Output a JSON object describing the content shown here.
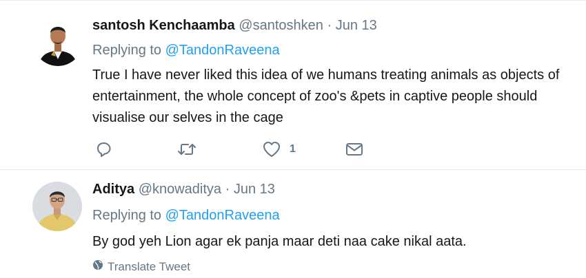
{
  "tweets": [
    {
      "fullname": "santosh Kenchaamba",
      "handle": "@santoshken",
      "separator": "·",
      "time": "Jun 13",
      "replying_prefix": "Replying to",
      "replying_to": "@TandonRaveena",
      "text": "True I have never liked this idea of we humans treating animals as objects of entertainment, the whole concept of zoo's  &pets in captive people should visualise our selves in the cage",
      "actions": {
        "reply_icon": "reply-icon",
        "retweet_icon": "retweet-icon",
        "like_icon": "heart-icon",
        "like_count": "1",
        "dm_icon": "envelope-icon"
      }
    },
    {
      "fullname": "Aditya",
      "handle": "@knowaditya",
      "separator": "·",
      "time": "Jun 13",
      "replying_prefix": "Replying to",
      "replying_to": "@TandonRaveena",
      "text": "By god yeh Lion agar ek panja maar deti naa cake nikal aata.",
      "translate_label": "Translate Tweet",
      "translate_icon": "globe-icon"
    }
  ],
  "colors": {
    "text": "#14171a",
    "secondary": "#657786",
    "link": "#1da1f2",
    "divider": "#e6ecf0"
  }
}
